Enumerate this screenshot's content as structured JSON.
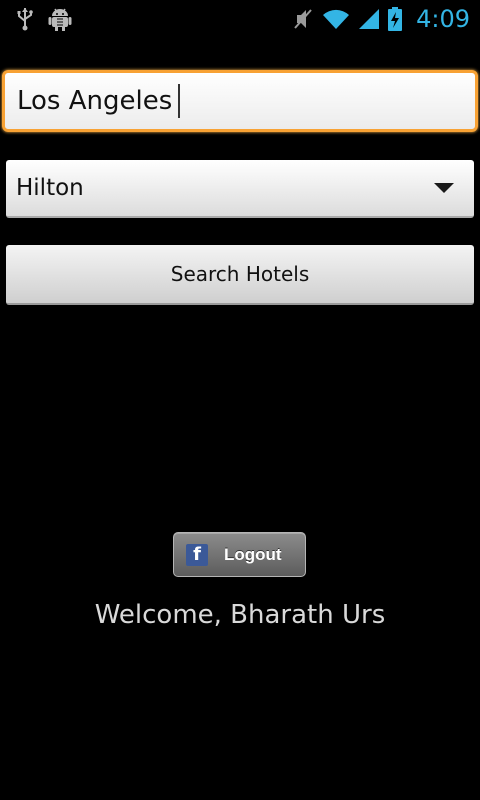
{
  "status_bar": {
    "time": "4:09",
    "time_color": "#33b5e5",
    "left_icons": [
      "usb-icon",
      "android-debug-icon"
    ],
    "right_icons": [
      "vibrate-muted-icon",
      "wifi-icon",
      "signal-icon",
      "battery-charging-icon"
    ]
  },
  "form": {
    "city_value": "Los Angeles",
    "chain_selected": "Hilton",
    "search_button_label": "Search Hotels"
  },
  "facebook": {
    "logo_letter": "f",
    "logout_label": "Logout",
    "brand_color": "#3b5998"
  },
  "welcome": {
    "text": "Welcome, Bharath Urs"
  },
  "accent_colors": {
    "focus_border": "#f8a234"
  }
}
